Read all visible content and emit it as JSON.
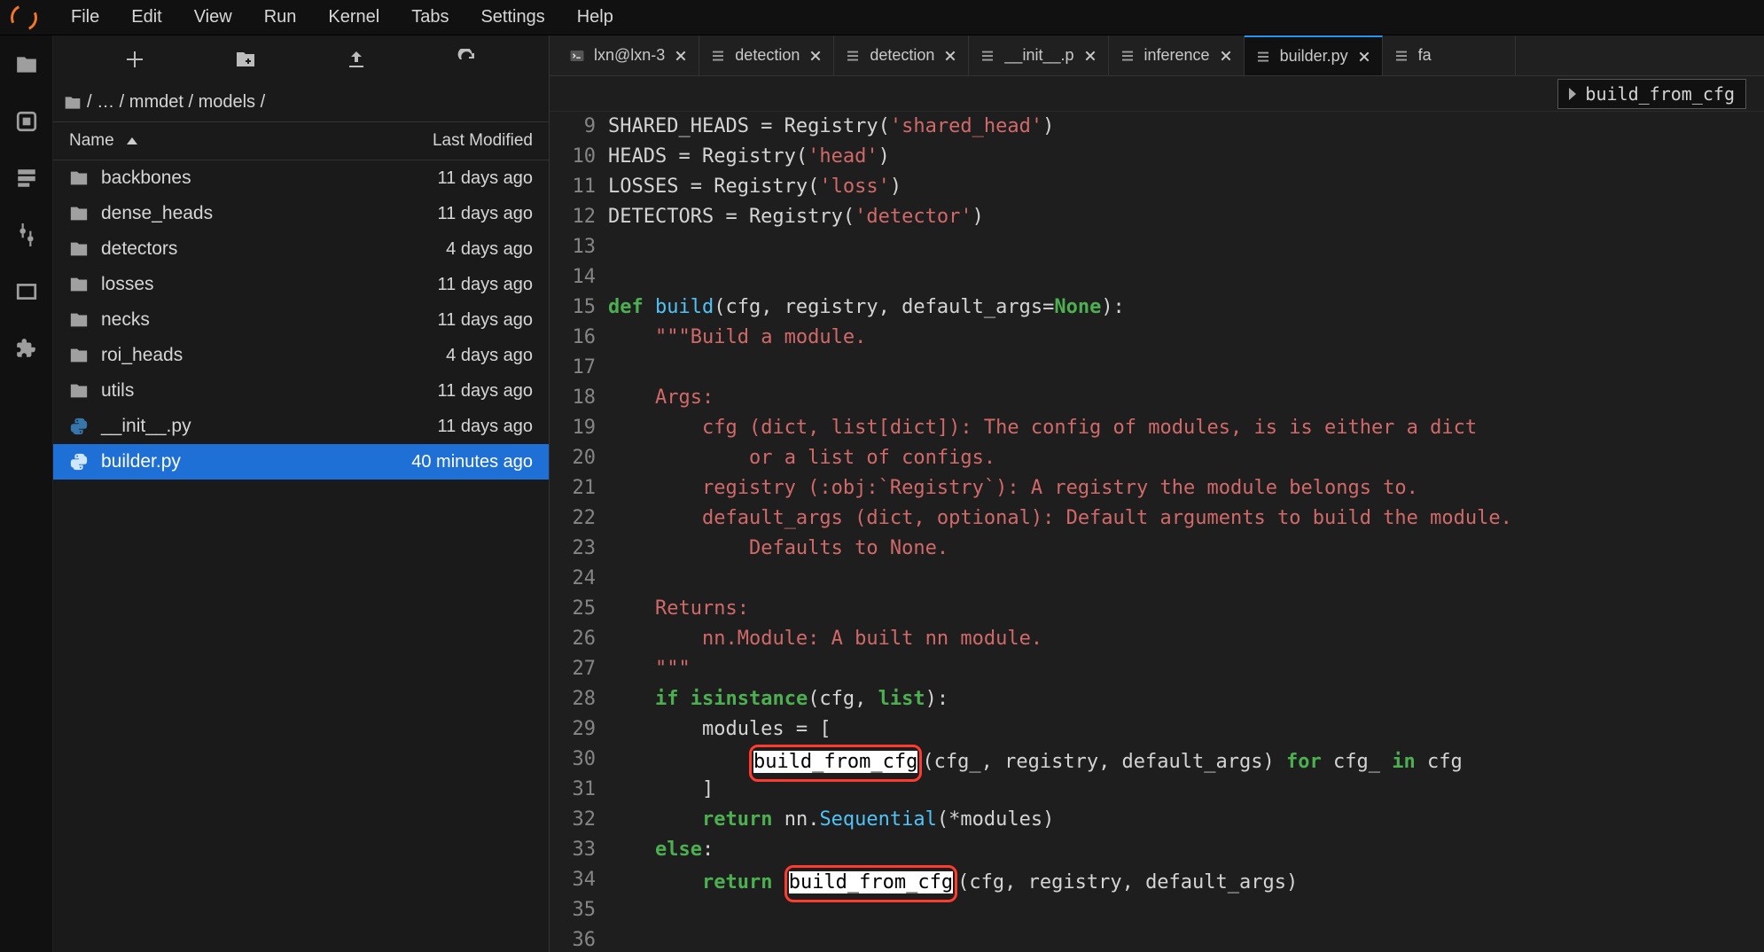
{
  "menubar": [
    "File",
    "Edit",
    "View",
    "Run",
    "Kernel",
    "Tabs",
    "Settings",
    "Help"
  ],
  "breadcrumb": [
    "/",
    "…",
    "/",
    "mmdet",
    "/",
    "models",
    "/"
  ],
  "file_header": {
    "name": "Name",
    "modified": "Last Modified"
  },
  "files": [
    {
      "kind": "folder",
      "name": "backbones",
      "modified": "11 days ago"
    },
    {
      "kind": "folder",
      "name": "dense_heads",
      "modified": "11 days ago"
    },
    {
      "kind": "folder",
      "name": "detectors",
      "modified": "4 days ago"
    },
    {
      "kind": "folder",
      "name": "losses",
      "modified": "11 days ago"
    },
    {
      "kind": "folder",
      "name": "necks",
      "modified": "11 days ago"
    },
    {
      "kind": "folder",
      "name": "roi_heads",
      "modified": "4 days ago"
    },
    {
      "kind": "folder",
      "name": "utils",
      "modified": "11 days ago"
    },
    {
      "kind": "py",
      "name": "__init__.py",
      "modified": "11 days ago"
    },
    {
      "kind": "py",
      "name": "builder.py",
      "modified": "40 minutes ago",
      "selected": true
    }
  ],
  "tabs": [
    {
      "icon": "terminal",
      "label": "lxn@lxn-3",
      "close": true
    },
    {
      "icon": "file",
      "label": "detection",
      "close": true
    },
    {
      "icon": "file",
      "label": "detection",
      "close": true
    },
    {
      "icon": "file",
      "label": "__init__.p",
      "close": true
    },
    {
      "icon": "file",
      "label": "inference",
      "close": true
    },
    {
      "icon": "file",
      "label": "builder.py",
      "close": true,
      "active": true
    },
    {
      "icon": "file",
      "label": "fa",
      "close": false
    }
  ],
  "symbol_path": "build_from_cfg",
  "code": {
    "first_line_no": 9,
    "lines": [
      [
        [
          "id",
          "SHARED_HEADS = Registry("
        ],
        [
          "str",
          "'shared_head'"
        ],
        [
          "id",
          ")"
        ]
      ],
      [
        [
          "id",
          "HEADS = Registry("
        ],
        [
          "str",
          "'head'"
        ],
        [
          "id",
          ")"
        ]
      ],
      [
        [
          "id",
          "LOSSES = Registry("
        ],
        [
          "str",
          "'loss'"
        ],
        [
          "id",
          ")"
        ]
      ],
      [
        [
          "id",
          "DETECTORS = Registry("
        ],
        [
          "str",
          "'detector'"
        ],
        [
          "id",
          ")"
        ]
      ],
      [],
      [],
      [
        [
          "kw",
          "def "
        ],
        [
          "fn",
          "build"
        ],
        [
          "id",
          "(cfg, registry, default_args="
        ],
        [
          "const",
          "None"
        ],
        [
          "id",
          "):"
        ]
      ],
      [
        [
          "id",
          "    "
        ],
        [
          "str",
          "\"\"\"Build a module."
        ]
      ],
      [],
      [
        [
          "id",
          "    "
        ],
        [
          "str",
          "Args:"
        ]
      ],
      [
        [
          "id",
          "        "
        ],
        [
          "str",
          "cfg (dict, list[dict]): The config of modules, is is either a dict"
        ]
      ],
      [
        [
          "id",
          "            "
        ],
        [
          "str",
          "or a list of configs."
        ]
      ],
      [
        [
          "id",
          "        "
        ],
        [
          "str",
          "registry (:obj:`Registry`): A registry the module belongs to."
        ]
      ],
      [
        [
          "id",
          "        "
        ],
        [
          "str",
          "default_args (dict, optional): Default arguments to build the module."
        ]
      ],
      [
        [
          "id",
          "            "
        ],
        [
          "str",
          "Defaults to None."
        ]
      ],
      [],
      [
        [
          "id",
          "    "
        ],
        [
          "str",
          "Returns:"
        ]
      ],
      [
        [
          "id",
          "        "
        ],
        [
          "str",
          "nn.Module: A built nn module."
        ]
      ],
      [
        [
          "id",
          "    "
        ],
        [
          "str",
          "\"\"\""
        ]
      ],
      [
        [
          "id",
          "    "
        ],
        [
          "kw",
          "if "
        ],
        [
          "builtin",
          "isinstance"
        ],
        [
          "id",
          "(cfg, "
        ],
        [
          "builtin",
          "list"
        ],
        [
          "id",
          "):"
        ]
      ],
      [
        [
          "id",
          "        modules = ["
        ]
      ],
      [
        [
          "id",
          "            "
        ],
        [
          "match",
          "build_from_cfg"
        ],
        [
          "id",
          "(cfg_, registry, default_args) "
        ],
        [
          "kw",
          "for"
        ],
        [
          "id",
          " cfg_ "
        ],
        [
          "kw",
          "in"
        ],
        [
          "id",
          " cfg"
        ]
      ],
      [
        [
          "id",
          "        ]"
        ]
      ],
      [
        [
          "id",
          "        "
        ],
        [
          "kw",
          "return"
        ],
        [
          "id",
          " nn."
        ],
        [
          "attr",
          "Sequential"
        ],
        [
          "id",
          "(*modules)"
        ]
      ],
      [
        [
          "id",
          "    "
        ],
        [
          "kw",
          "else"
        ],
        [
          "id",
          ":"
        ]
      ],
      [
        [
          "id",
          "        "
        ],
        [
          "kw",
          "return"
        ],
        [
          "id",
          " "
        ],
        [
          "match",
          "build_from_cfg"
        ],
        [
          "id",
          "(cfg, registry, default_args)"
        ]
      ],
      [],
      []
    ],
    "match_value": "build_from_cfg"
  }
}
